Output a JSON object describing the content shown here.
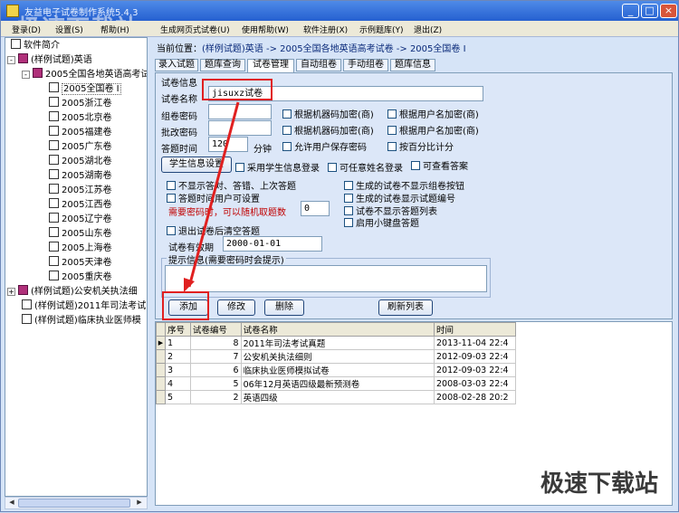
{
  "window": {
    "title": "友益电子试卷制作系统5.4.3"
  },
  "watermark": {
    "top": "极速下载站",
    "bottom": "极速下载站"
  },
  "menubar": {
    "items": [
      "登录(D)",
      "设置(S)",
      "帮助(H)",
      "生成网页式试卷(U)",
      "使用帮助(W)",
      "软件注册(X)",
      "示例题库(Y)",
      "退出(Z)"
    ]
  },
  "tree": {
    "root_items": [
      "软件简介",
      "(样例试题)英语",
      "2005全国各地英语高考试"
    ],
    "selected": "2005全国卷 I",
    "children": [
      "2005浙江卷",
      "2005北京卷",
      "2005福建卷",
      "2005广东卷",
      "2005湖北卷",
      "2005湖南卷",
      "2005江苏卷",
      "2005江西卷",
      "2005辽宁卷",
      "2005山东卷",
      "2005上海卷",
      "2005天津卷",
      "2005重庆卷"
    ],
    "other_roots": [
      "(样例试题)公安机关执法细",
      "(样例试题)2011年司法考试",
      "(样例试题)临床执业医师模"
    ]
  },
  "location": {
    "label": "当前位置：",
    "path": "(样例试题)英语 -> 2005全国各地英语高考试卷 -> 2005全国卷 I"
  },
  "tabs": [
    "录入试题",
    "题库查询",
    "试卷管理",
    "自动组卷",
    "手动组卷",
    "题库信息"
  ],
  "form": {
    "group_title": "试卷信息",
    "name_label": "试卷名称",
    "name_value": "jisuxz试卷",
    "zujuan_label": "组卷密码",
    "zujuan_value": "",
    "pijuan_label": "批改密码",
    "pijuan_value": "",
    "time_label": "答题时间",
    "time_value": "120",
    "time_unit": "分钟",
    "chk_machine1": "根据机器码加密(商)",
    "chk_user1": "根据用户名加密(商)",
    "chk_machine2": "根据机器码加密(商)",
    "chk_user2": "根据用户名加密(商)",
    "chk_save_pwd": "允许用户保存密码",
    "chk_percent": "按百分比计分",
    "student_btn": "学生信息设置",
    "chk_student_login": "采用学生信息登录",
    "chk_anonymous": "可任意姓名登录",
    "chk_view_answer": "可查看答案",
    "chk_hide_last": "不显示答对、答错、上次答题",
    "chk_user_time": "答题时间用户可设置",
    "random_label": "需要密码时，可以随机取题数",
    "random_value": "0",
    "chk_no_group_btn": "生成的试卷不显示组卷按钮",
    "chk_show_number": "生成的试卷显示试题编号",
    "chk_no_list": "试卷不显示答题列表",
    "chk_keyboard": "启用小键盘答题",
    "chk_clear_on_exit": "退出试卷后清空答题",
    "valid_label": "试卷有效期",
    "valid_value": "2000-01-01",
    "hint_legend": "提示信息(需要密码时会提示)",
    "hint_value": ""
  },
  "buttons": {
    "add": "添加",
    "edit": "修改",
    "delete": "删除",
    "refresh": "刷新列表"
  },
  "grid": {
    "columns": [
      "序号",
      "试卷编号",
      "试卷名称",
      "时间"
    ],
    "rows": [
      {
        "seq": "1",
        "id": "8",
        "name": "2011年司法考试真题",
        "time": "2013-11-04 22:4"
      },
      {
        "seq": "2",
        "id": "7",
        "name": "公安机关执法细则",
        "time": "2012-09-03 22:4"
      },
      {
        "seq": "3",
        "id": "6",
        "name": "临床执业医师模拟试卷",
        "time": "2012-09-03 22:4"
      },
      {
        "seq": "4",
        "id": "5",
        "name": "06年12月英语四级最新预测卷",
        "time": "2008-03-03 22:4"
      },
      {
        "seq": "5",
        "id": "2",
        "name": "英语四级",
        "time": "2008-02-28 20:2"
      }
    ]
  },
  "colors": {
    "highlight": "#e02020",
    "title_blue": "#2560d0"
  },
  "icons": [
    "book-icon",
    "document-icon",
    "minimize-icon",
    "maximize-icon",
    "close-icon"
  ]
}
